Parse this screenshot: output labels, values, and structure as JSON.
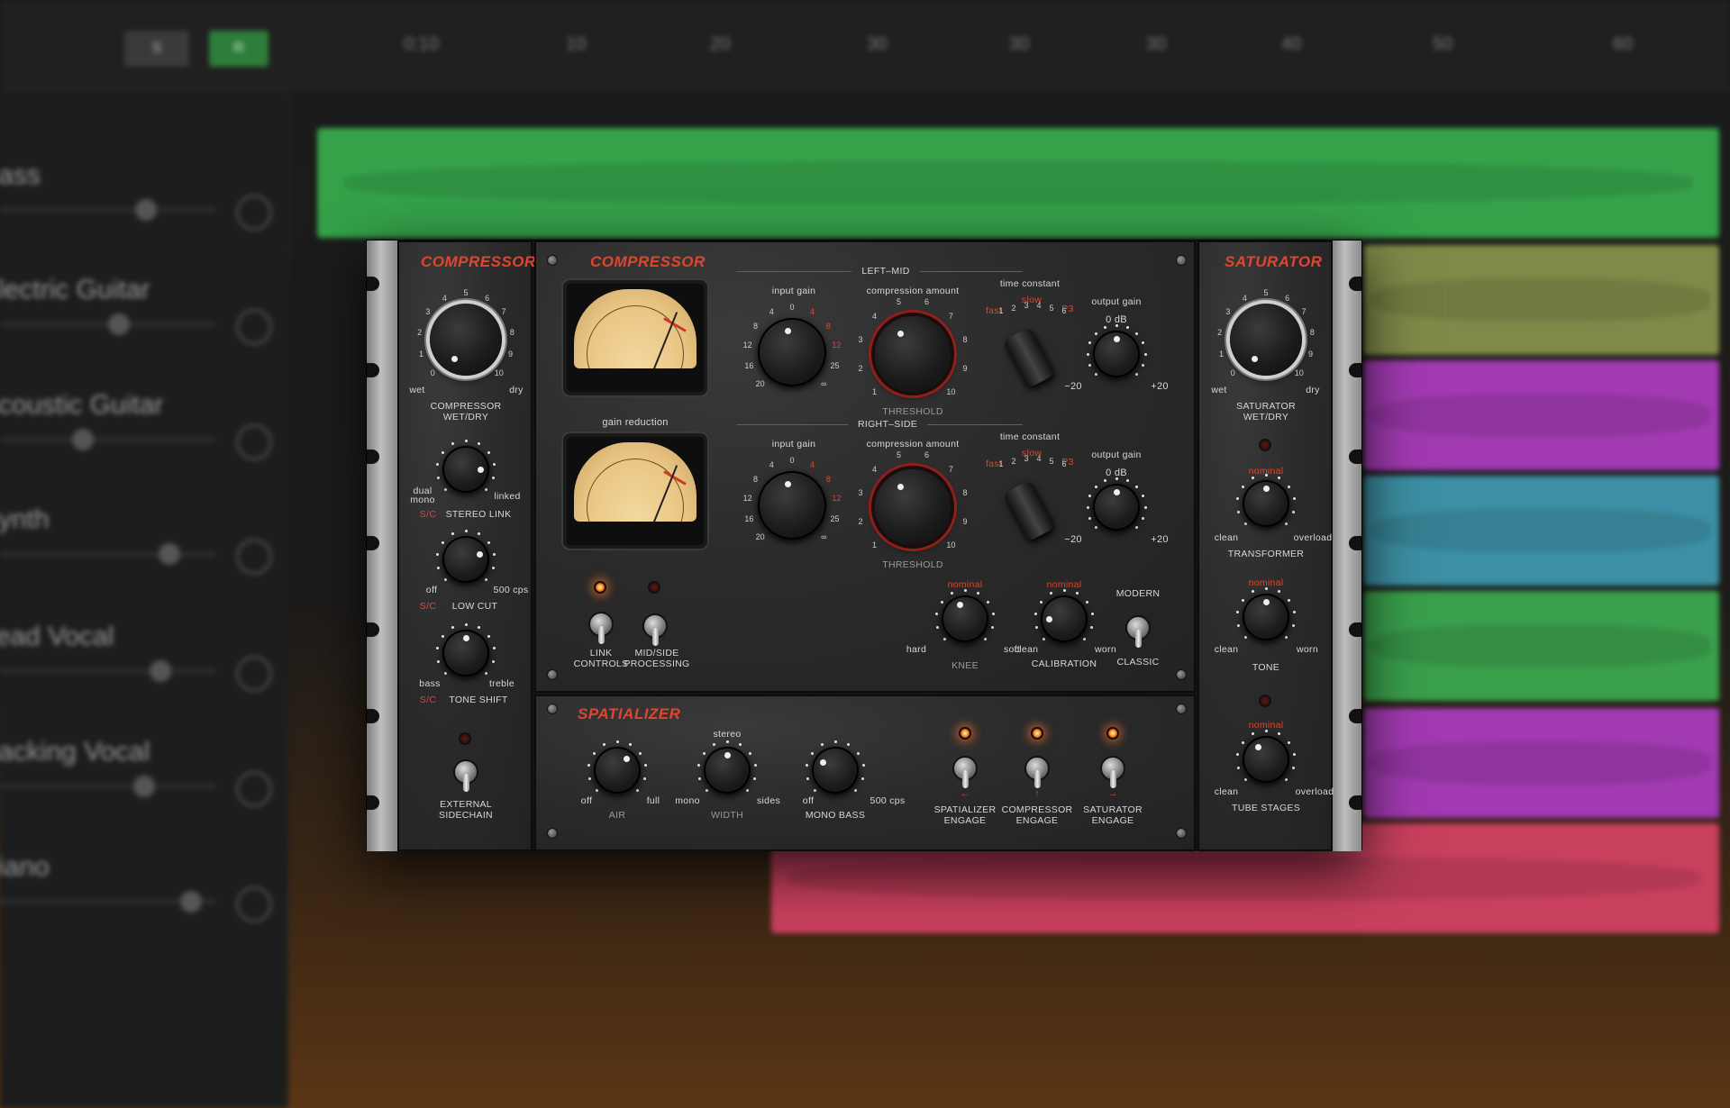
{
  "daw": {
    "buttons": {
      "s": "S",
      "r": "R"
    },
    "ruler": [
      "0:10",
      "10",
      "20",
      "30",
      "30",
      "30",
      "40",
      "50",
      "60"
    ],
    "tracks": [
      {
        "name": "Bass"
      },
      {
        "name": "Electric Guitar"
      },
      {
        "name": "Acoustic Guitar"
      },
      {
        "name": "Synth"
      },
      {
        "name": "Lead Vocal"
      },
      {
        "name": "Backing Vocal"
      },
      {
        "name": "Piano"
      }
    ],
    "region_colors": [
      "#35a24a",
      "#7f8a48",
      "#a23ab2",
      "#3c8fa4",
      "#3aa04c",
      "#a23ab2",
      "#c8405e"
    ]
  },
  "plugin": {
    "left": {
      "title": "COMPRESSOR",
      "wetdry": {
        "label1": "COMPRESSOR",
        "label2": "WET/DRY",
        "min": "wet",
        "max": "dry",
        "nums": [
          "0",
          "1",
          "2",
          "3",
          "4",
          "5",
          "6",
          "7",
          "8",
          "9",
          "10"
        ]
      },
      "stereo_link": {
        "prefix": "S/C",
        "label": "STEREO LINK",
        "min1": "dual",
        "min2": "mono",
        "max": "linked"
      },
      "low_cut": {
        "prefix": "S/C",
        "label": "LOW CUT",
        "min": "off",
        "max": "500 cps"
      },
      "tone_shift": {
        "prefix": "S/C",
        "label": "TONE SHIFT",
        "min": "bass",
        "max": "treble"
      },
      "ext_sidechain": {
        "label1": "EXTERNAL",
        "label2": "SIDECHAIN"
      }
    },
    "center": {
      "title": "COMPRESSOR",
      "section_left_mid": "LEFT–MID",
      "section_right_side": "RIGHT–SIDE",
      "meter_caption": "gain reduction",
      "input_gain": {
        "label": "input gain",
        "nums": [
          "20",
          "16",
          "12",
          "8",
          "4",
          "0",
          "4",
          "8",
          "12",
          "25",
          "∞"
        ]
      },
      "comp_amount": {
        "label": "compression amount",
        "nums": [
          "1",
          "2",
          "3",
          "4",
          "5",
          "6",
          "7",
          "8",
          "9",
          "10"
        ],
        "sublabel": "THRESHOLD"
      },
      "time_constant": {
        "label": "time constant",
        "fast": "fast",
        "slow": "slow",
        "nums": [
          "1",
          "2",
          "3",
          "4",
          "5",
          "6"
        ],
        "p": "P3"
      },
      "output_gain": {
        "label": "output gain",
        "zero": "0 dB",
        "min": "−20",
        "max": "+20"
      },
      "link_controls": {
        "l1": "LINK",
        "l2": "CONTROLS"
      },
      "mid_side": {
        "l1": "MID/SIDE",
        "l2": "PROCESSING"
      },
      "knee": {
        "nominal": "nominal",
        "min": "hard",
        "max": "soft",
        "label": "KNEE"
      },
      "calibration": {
        "nominal": "nominal",
        "min": "clean",
        "max": "worn",
        "label": "CALIBRATION"
      },
      "mode": {
        "top": "MODERN",
        "bottom": "CLASSIC"
      }
    },
    "spatializer": {
      "title": "SPATIALIZER",
      "air": {
        "min": "off",
        "max": "full",
        "label": "AIR"
      },
      "width": {
        "top": "stereo",
        "min": "mono",
        "max": "sides",
        "label": "WIDTH"
      },
      "mono_bass": {
        "min": "off",
        "max": "500 cps",
        "label": "MONO BASS"
      },
      "engage": [
        {
          "l1": "SPATIALIZER",
          "l2": "ENGAGE",
          "arrow": "←"
        },
        {
          "l1": "COMPRESSOR",
          "l2": "ENGAGE",
          "arrow": "↑"
        },
        {
          "l1": "SATURATOR",
          "l2": "ENGAGE",
          "arrow": "→"
        }
      ]
    },
    "right": {
      "title": "SATURATOR",
      "wetdry": {
        "label1": "SATURATOR",
        "label2": "WET/DRY",
        "min": "wet",
        "max": "dry"
      },
      "transformer": {
        "nominal": "nominal",
        "min": "clean",
        "max": "overload",
        "label": "TRANSFORMER"
      },
      "tone": {
        "nominal": "nominal",
        "min": "clean",
        "max": "worn",
        "label": "TONE"
      },
      "tube_stages": {
        "nominal": "nominal",
        "min": "clean",
        "max": "overload",
        "label": "TUBE STAGES"
      }
    }
  }
}
